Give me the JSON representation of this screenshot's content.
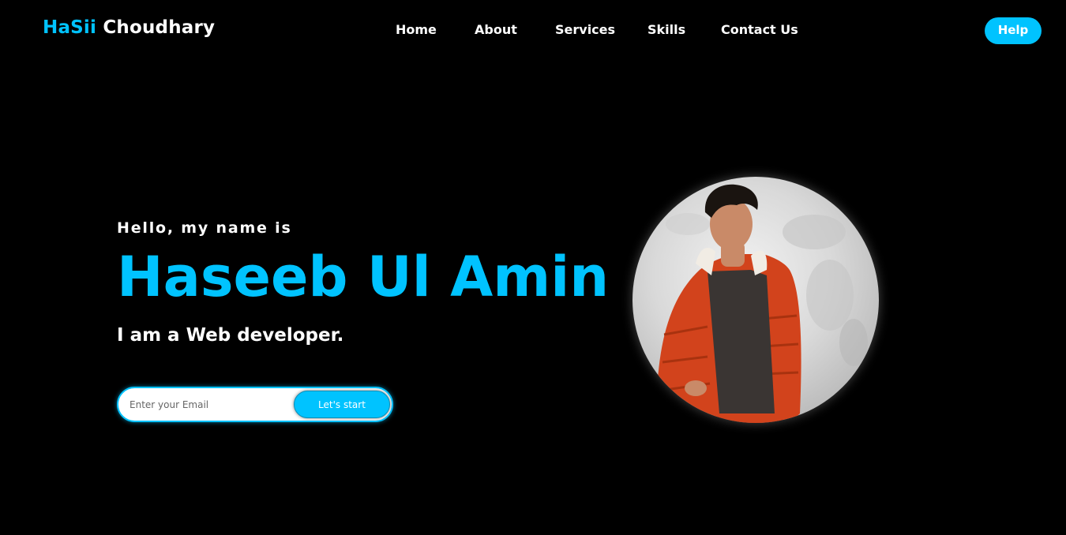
{
  "logo": {
    "accent": "HaSii",
    "rest": "Choudhary"
  },
  "nav": {
    "items": [
      {
        "label": "Home"
      },
      {
        "label": "About"
      },
      {
        "label": "Services"
      },
      {
        "label": "Skills"
      },
      {
        "label": "Contact Us"
      }
    ],
    "help_label": "Help"
  },
  "hero": {
    "greeting": "Hello, my name is",
    "name": "Haseeb Ul Amin",
    "role": "I am a Web developer.",
    "email_placeholder": "Enter your Email",
    "start_label": "Let's start"
  },
  "colors": {
    "accent": "#00c3ff",
    "background": "#000000"
  }
}
